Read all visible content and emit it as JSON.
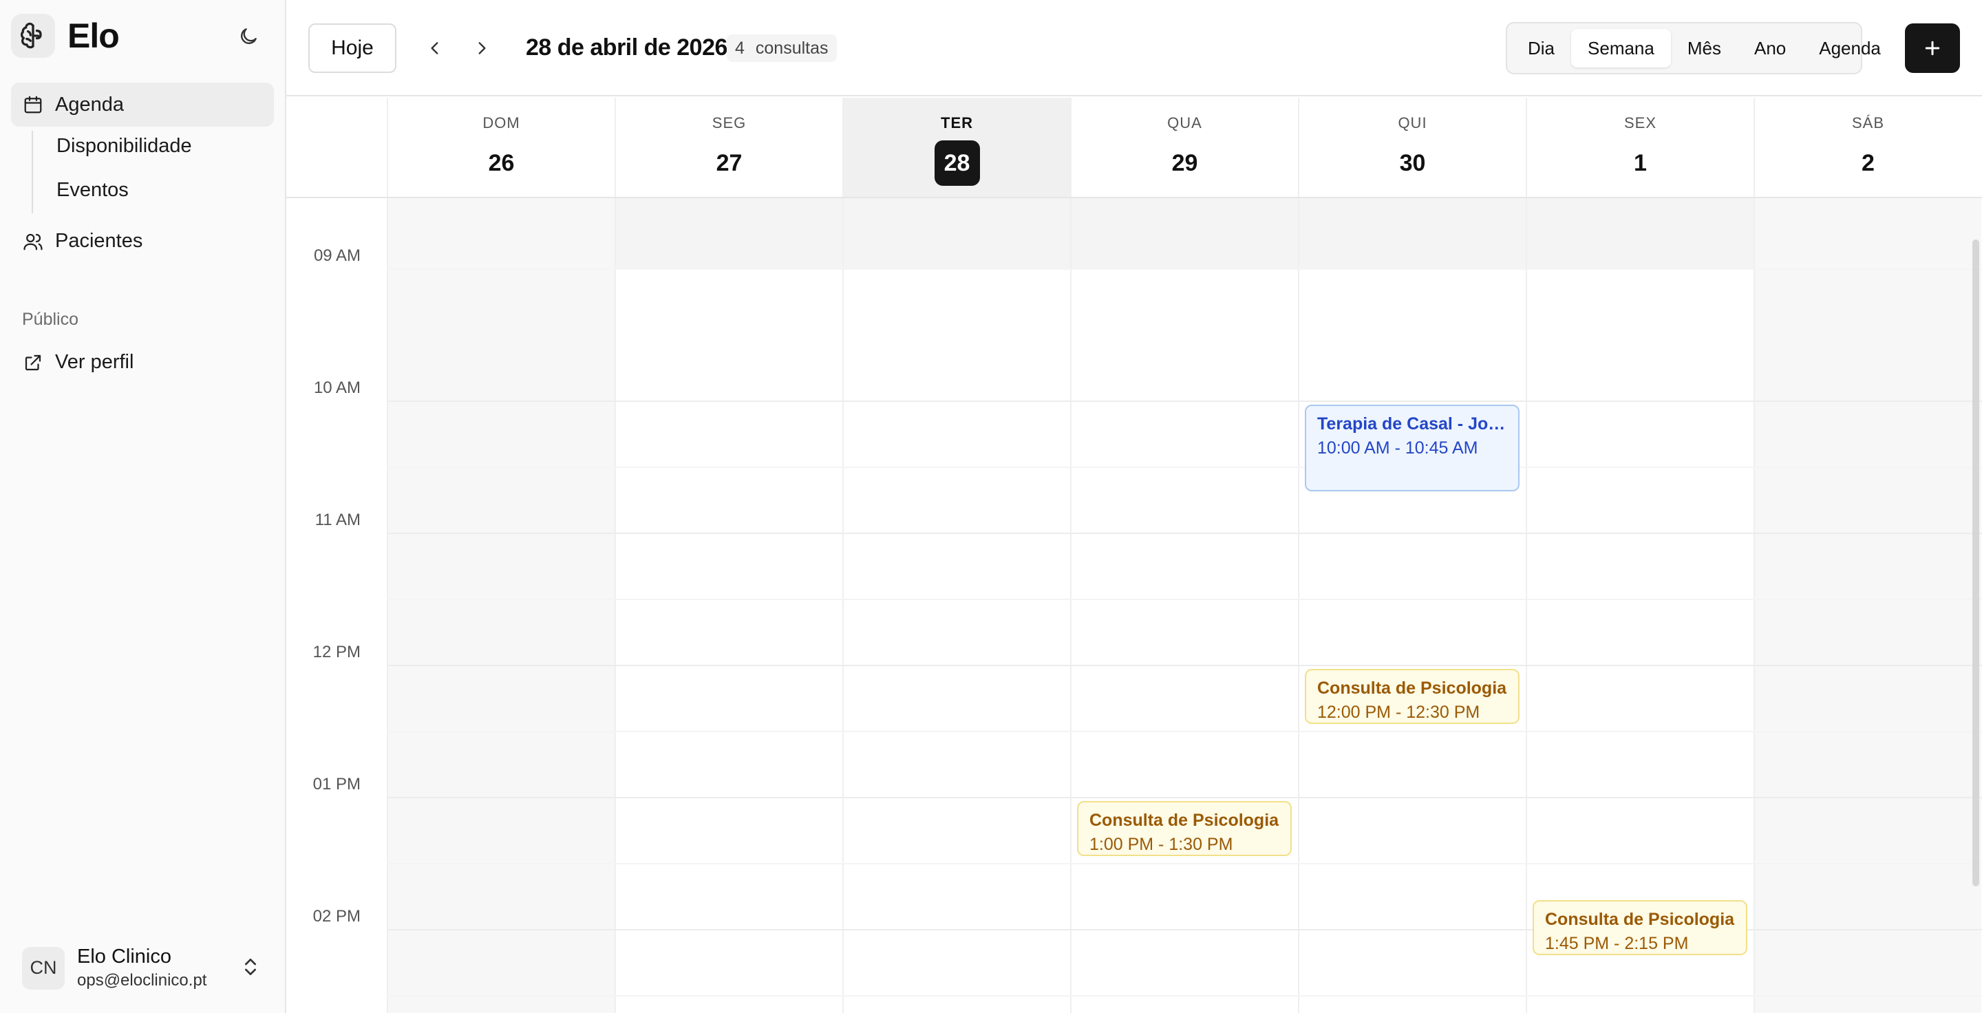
{
  "app": {
    "name": "Elo"
  },
  "sidebar": {
    "items": [
      {
        "label": "Agenda"
      },
      {
        "label": "Disponibilidade"
      },
      {
        "label": "Eventos"
      },
      {
        "label": "Pacientes"
      }
    ],
    "section_public": "Público",
    "public_items": [
      {
        "label": "Ver perfil"
      }
    ],
    "user": {
      "initials": "CN",
      "name": "Elo Clinico",
      "email": "ops@eloclinico.pt"
    }
  },
  "toolbar": {
    "today_label": "Hoje",
    "date_title": "28 de abril de 2026",
    "count": "4",
    "count_label": "consultas",
    "views": [
      "Dia",
      "Semana",
      "Mês",
      "Ano",
      "Agenda"
    ],
    "active_view": "Semana"
  },
  "week": {
    "days": [
      {
        "dow": "DOM",
        "num": "26"
      },
      {
        "dow": "SEG",
        "num": "27"
      },
      {
        "dow": "TER",
        "num": "28",
        "today": true
      },
      {
        "dow": "QUA",
        "num": "29"
      },
      {
        "dow": "QUI",
        "num": "30"
      },
      {
        "dow": "SEX",
        "num": "1"
      },
      {
        "dow": "SÁB",
        "num": "2"
      }
    ],
    "time_labels": [
      "09 AM",
      "10 AM",
      "11 AM",
      "12 PM",
      "01 PM",
      "02 PM"
    ]
  },
  "events": [
    {
      "title": "Terapia de Casal - João",
      "time": "10:00 AM - 10:45 AM",
      "color": "blue"
    },
    {
      "title": "Consulta de Psicologia",
      "time": "12:00 PM - 12:30 PM",
      "color": "amber"
    },
    {
      "title": "Consulta de Psicologia",
      "time": "1:00 PM - 1:30 PM",
      "color": "amber"
    },
    {
      "title": "Consulta de Psicologia",
      "time": "1:45 PM - 2:15 PM",
      "color": "amber"
    }
  ]
}
